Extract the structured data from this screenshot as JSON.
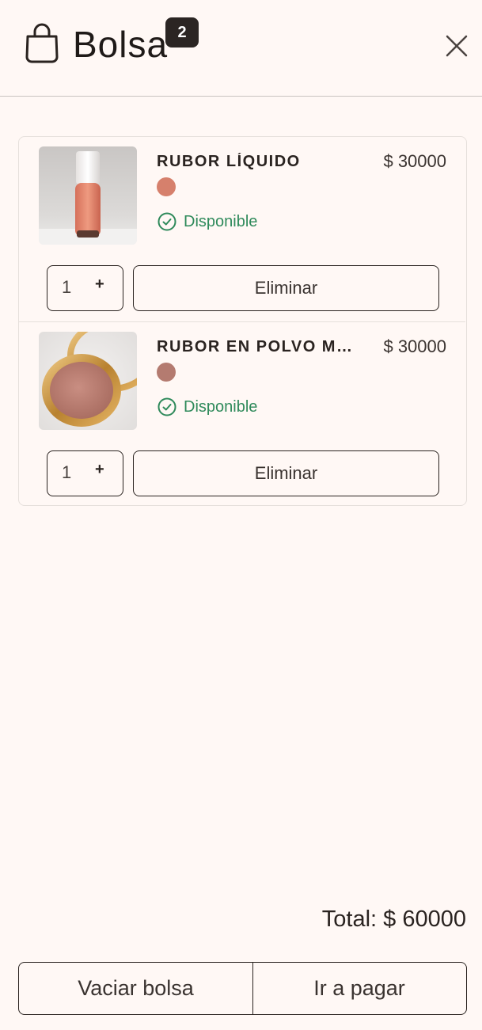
{
  "header": {
    "title": "Bolsa",
    "count": "2",
    "bag_icon": "shopping-bag-icon",
    "close_icon": "close-icon"
  },
  "items": [
    {
      "name": "RUBOR LÍQUIDO",
      "price": "$ 30000",
      "swatch_color": "#d6806c",
      "availability": "Disponible",
      "quantity": "1",
      "plus_label": "+",
      "remove_label": "Eliminar",
      "image": "liquid-blush-bottle"
    },
    {
      "name": "RUBOR EN POLVO MINERAL",
      "price": "$ 30000",
      "swatch_color": "#b47b70",
      "availability": "Disponible",
      "quantity": "1",
      "plus_label": "+",
      "remove_label": "Eliminar",
      "image": "powder-blush-compact"
    }
  ],
  "footer": {
    "total": "Total: $ 60000",
    "empty_label": "Vaciar bolsa",
    "pay_label": "Ir a pagar"
  },
  "colors": {
    "background": "#fff8f5",
    "text": "#2a2320",
    "available": "#2f8a5b"
  }
}
